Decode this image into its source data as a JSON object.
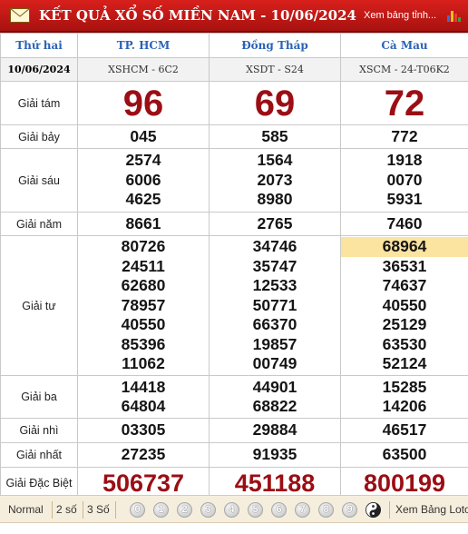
{
  "header": {
    "title": "KẾT QUẢ XỔ SỐ MIỀN NAM - 10/06/2024",
    "link": "Xem bảng tỉnh..."
  },
  "table": {
    "weekday": "Thứ hai",
    "date": "10/06/2024",
    "provinces": [
      {
        "name": "TP. HCM",
        "code": "XSHCM - 6C2"
      },
      {
        "name": "Đồng Tháp",
        "code": "XSDT - S24"
      },
      {
        "name": "Cà Mau",
        "code": "XSCM - 24-T06K2"
      }
    ],
    "prizes": {
      "g8": {
        "label": "Giải tám",
        "values": [
          "96",
          "69",
          "72"
        ]
      },
      "g7": {
        "label": "Giải bảy",
        "values": [
          "045",
          "585",
          "772"
        ]
      },
      "g6": {
        "label": "Giải sáu",
        "values": [
          [
            "2574",
            "6006",
            "4625"
          ],
          [
            "1564",
            "2073",
            "8980"
          ],
          [
            "1918",
            "0070",
            "5931"
          ]
        ]
      },
      "g5": {
        "label": "Giải năm",
        "values": [
          "8661",
          "2765",
          "7460"
        ]
      },
      "g4": {
        "label": "Giải tư",
        "values": [
          [
            "80726",
            "24511",
            "62680",
            "78957",
            "40550",
            "85396",
            "11062"
          ],
          [
            "34746",
            "35747",
            "12533",
            "50771",
            "66370",
            "19857",
            "00749"
          ],
          [
            "68964",
            "36531",
            "74637",
            "40550",
            "25129",
            "63530",
            "52124"
          ]
        ]
      },
      "g3": {
        "label": "Giải ba",
        "values": [
          [
            "14418",
            "64804"
          ],
          [
            "44901",
            "68822"
          ],
          [
            "15285",
            "14206"
          ]
        ]
      },
      "g2": {
        "label": "Giải nhì",
        "values": [
          "03305",
          "29884",
          "46517"
        ]
      },
      "g1": {
        "label": "Giải nhất",
        "values": [
          "27235",
          "91935",
          "63500"
        ]
      },
      "db": {
        "label": "Giải Đặc Biệt",
        "values": [
          "506737",
          "451188",
          "800199"
        ]
      }
    },
    "highlight_color": "#fbe3a0",
    "number_color": "#9b0e14"
  },
  "footer": {
    "modes": [
      "Normal",
      "2 số",
      "3 Số"
    ],
    "digits": [
      "0",
      "1",
      "2",
      "3",
      "4",
      "5",
      "6",
      "7",
      "8",
      "9"
    ],
    "link": "Xem Bảng Loto"
  }
}
